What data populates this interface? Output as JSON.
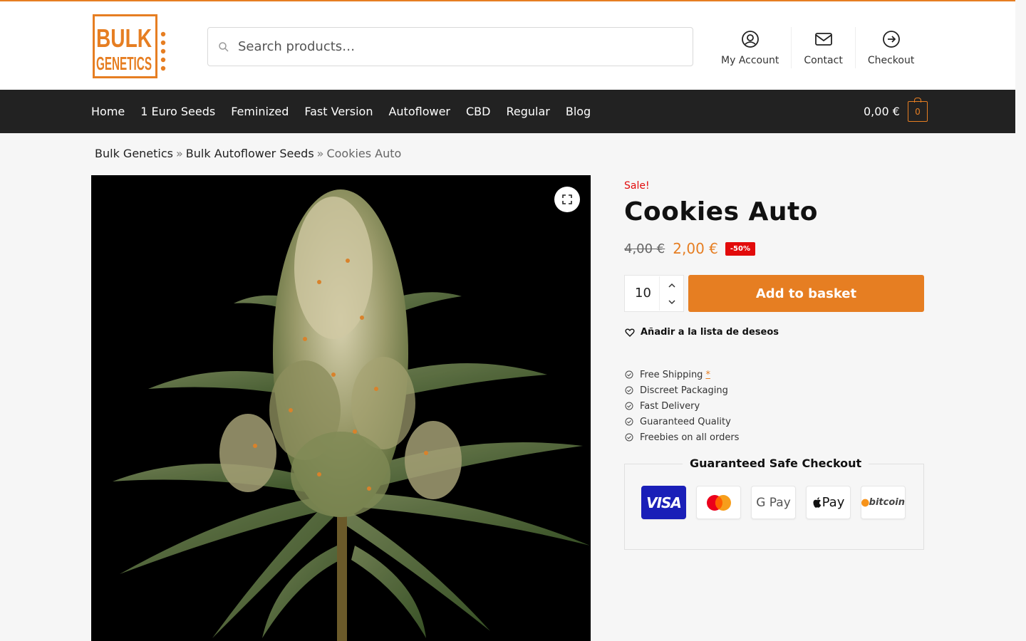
{
  "brand": {
    "logo_line1": "BULK",
    "logo_line2": "GENETICS",
    "accent_color": "#e67e22",
    "dark_color": "#222222"
  },
  "search": {
    "placeholder": "Search products…",
    "icon": "search-icon"
  },
  "header_links": [
    {
      "label": "My Account",
      "icon": "user-circle-icon"
    },
    {
      "label": "Contact",
      "icon": "envelope-icon"
    },
    {
      "label": "Checkout",
      "icon": "arrow-circle-right-icon"
    }
  ],
  "nav": {
    "items": [
      "Home",
      "1 Euro Seeds",
      "Feminized",
      "Fast Version",
      "Autoflower",
      "CBD",
      "Regular",
      "Blog"
    ],
    "cart_total": "0,00 €",
    "cart_count": "0"
  },
  "breadcrumb": {
    "items": [
      "Bulk Genetics",
      "Bulk Autoflower Seeds"
    ],
    "separator": "»",
    "current": "Cookies Auto"
  },
  "product": {
    "sale_label": "Sale!",
    "title": "Cookies Auto",
    "old_price": "4,00 €",
    "new_price": "2,00 €",
    "discount": "-50%",
    "quantity": "10",
    "add_button": "Add to basket",
    "wishlist": "Añadir a la lista de deseos",
    "image_alt": "cannabis plant on black background"
  },
  "perks": [
    {
      "label": "Free Shipping",
      "mark": "*"
    },
    {
      "label": "Discreet Packaging"
    },
    {
      "label": "Fast Delivery"
    },
    {
      "label": "Guaranteed Quality"
    },
    {
      "label": "Freebies on all orders"
    }
  ],
  "checkout": {
    "title": "Guaranteed Safe Checkout",
    "methods": {
      "visa": "VISA",
      "gpay": "G Pay",
      "applepay": "Pay",
      "bitcoin": "bitcoin"
    }
  }
}
